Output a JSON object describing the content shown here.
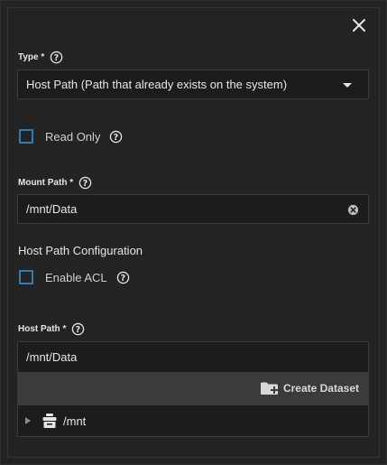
{
  "close_icon": "close-icon",
  "type_field": {
    "label": "Type",
    "required_mark": "*",
    "value": "Host Path (Path that already exists on the system)"
  },
  "read_only": {
    "label": "Read Only",
    "checked": false
  },
  "mount_path": {
    "label": "Mount Path",
    "required_mark": "*",
    "value": "/mnt/Data"
  },
  "host_path_config": {
    "title": "Host Path Configuration"
  },
  "enable_acl": {
    "label": "Enable ACL",
    "checked": false
  },
  "host_path": {
    "label": "Host Path",
    "required_mark": "*",
    "value": "/mnt/Data",
    "create_dataset_label": "Create Dataset",
    "tree": [
      {
        "name": "/mnt",
        "icon": "dataset-icon",
        "expanded": false
      }
    ]
  },
  "colors": {
    "accent": "#2c7bb5",
    "background": "#232323",
    "input_bg": "#1c1c1c",
    "toolbar_bg": "#3b3b3b"
  }
}
